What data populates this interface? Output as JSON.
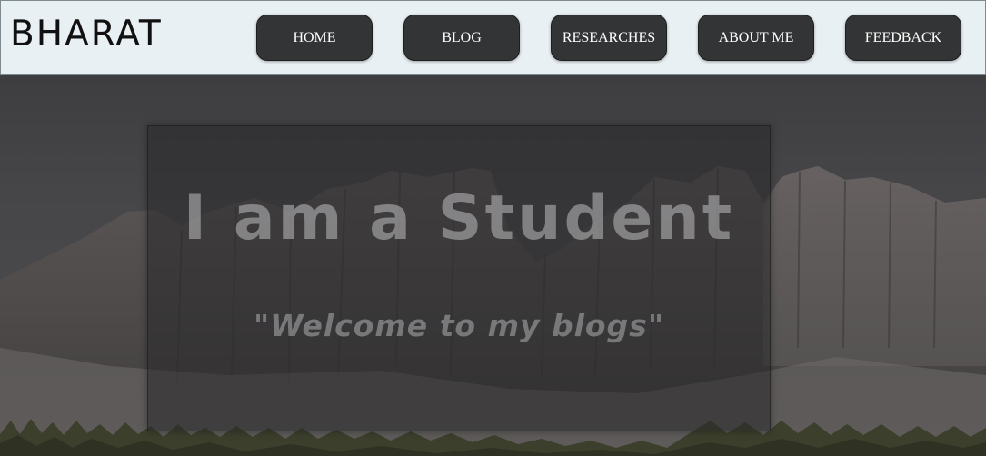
{
  "brand": {
    "name": "BHARAT"
  },
  "nav": {
    "items": [
      {
        "label": "HOME"
      },
      {
        "label": "BLOG"
      },
      {
        "label": "RESEARCHES"
      },
      {
        "label": "ABOUT ME"
      },
      {
        "label": "FEEDBACK"
      }
    ]
  },
  "hero": {
    "headline": "I am a Student",
    "tagline": "\"Welcome to my blogs\""
  }
}
